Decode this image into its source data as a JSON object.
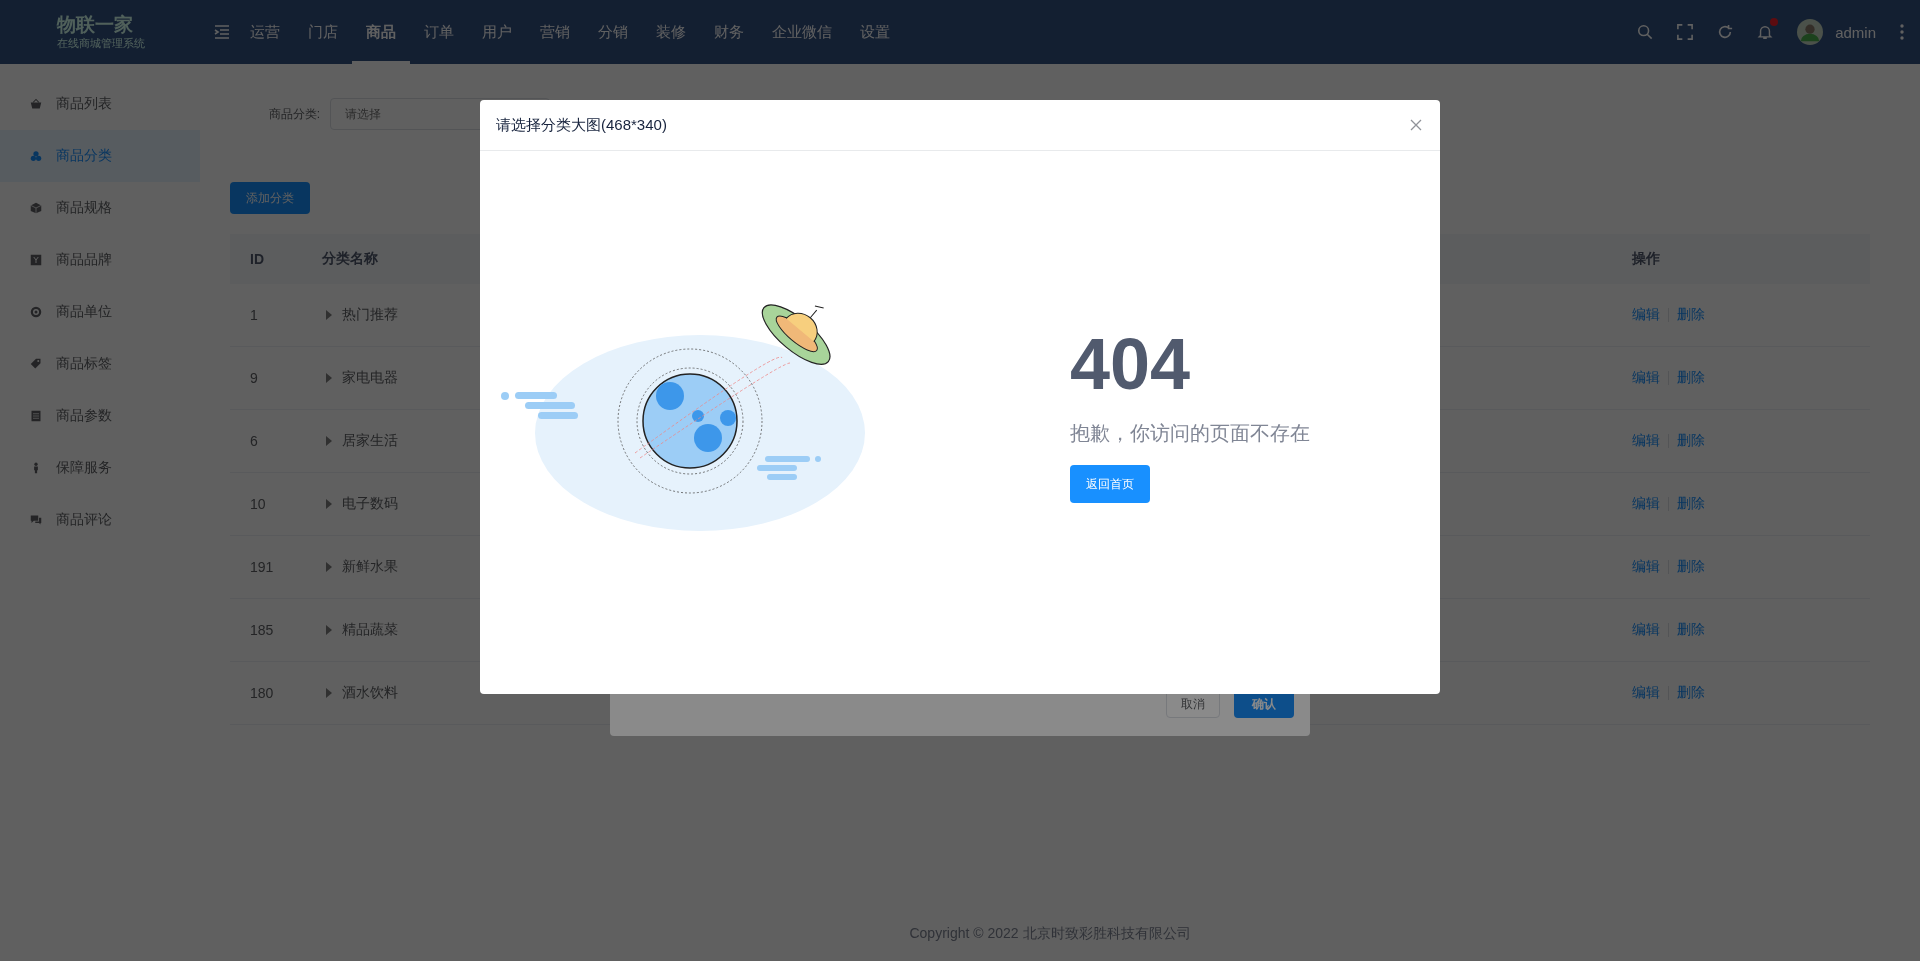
{
  "header": {
    "logo_title": "物联一家",
    "logo_subtitle": "在线商城管理系统",
    "nav": [
      {
        "label": "运营",
        "selected": false
      },
      {
        "label": "门店",
        "selected": false
      },
      {
        "label": "商品",
        "selected": true
      },
      {
        "label": "订单",
        "selected": false
      },
      {
        "label": "用户",
        "selected": false
      },
      {
        "label": "营销",
        "selected": false
      },
      {
        "label": "分销",
        "selected": false
      },
      {
        "label": "装修",
        "selected": false
      },
      {
        "label": "财务",
        "selected": false
      },
      {
        "label": "企业微信",
        "selected": false
      },
      {
        "label": "设置",
        "selected": false
      }
    ],
    "notification_unread": true,
    "user_name": "admin"
  },
  "sidebar": {
    "items": [
      {
        "label": "商品列表",
        "selected": false
      },
      {
        "label": "商品分类",
        "selected": true
      },
      {
        "label": "商品规格",
        "selected": false
      },
      {
        "label": "商品品牌",
        "selected": false
      },
      {
        "label": "商品单位",
        "selected": false
      },
      {
        "label": "商品标签",
        "selected": false
      },
      {
        "label": "商品参数",
        "selected": false
      },
      {
        "label": "保障服务",
        "selected": false
      },
      {
        "label": "商品评论",
        "selected": false
      }
    ]
  },
  "filter": {
    "label": "商品分类:",
    "placeholder": "请选择"
  },
  "add_button": "添加分类",
  "table": {
    "columns": [
      "ID",
      "分类名称",
      "操作"
    ],
    "rows": [
      {
        "id": "1",
        "name": "热门推荐",
        "expanded": false,
        "actions": [
          "编辑",
          "删除"
        ]
      },
      {
        "id": "9",
        "name": "家电电器",
        "expanded": false,
        "actions": [
          "编辑",
          "删除"
        ]
      },
      {
        "id": "6",
        "name": "居家生活",
        "expanded": false,
        "actions": [
          "编辑",
          "删除"
        ]
      },
      {
        "id": "10",
        "name": "电子数码",
        "expanded": false,
        "actions": [
          "编辑",
          "删除"
        ]
      },
      {
        "id": "191",
        "name": "新鲜水果",
        "expanded": false,
        "actions": [
          "编辑",
          "删除"
        ]
      },
      {
        "id": "185",
        "name": "精品蔬菜",
        "expanded": false,
        "actions": [
          "编辑",
          "删除"
        ]
      },
      {
        "id": "180",
        "name": "酒水饮料",
        "expanded": false,
        "actions": [
          "编辑",
          "删除"
        ]
      }
    ]
  },
  "edit_dialog": {
    "buttons": [
      {
        "label": "取消",
        "kind": "default"
      },
      {
        "label": "确认",
        "kind": "primary"
      }
    ]
  },
  "image_dialog": {
    "title": "请选择分类大图(468*340)",
    "error_code": "404",
    "message": "抱歉，你访问的页面不存在",
    "button": "返回首页"
  },
  "footer": {
    "copyright": "Copyright © 2022 北京时致彩胜科技有限公司"
  }
}
